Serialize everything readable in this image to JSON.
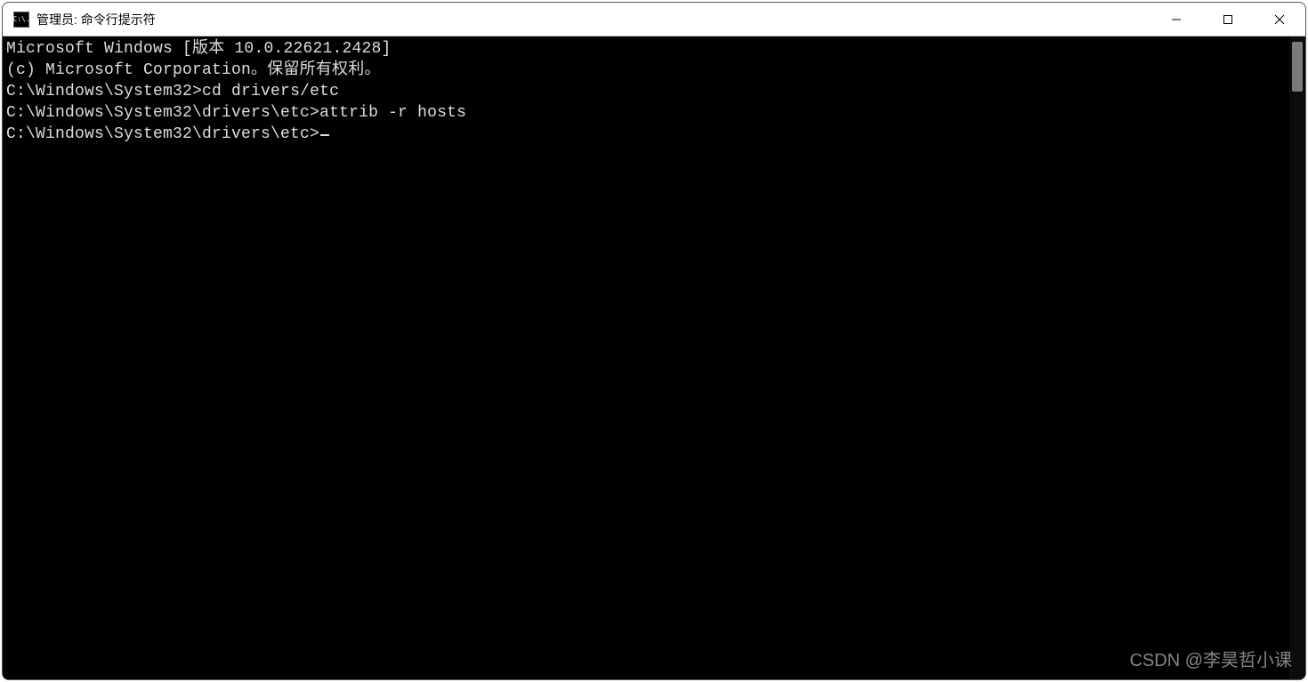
{
  "title": "管理员: 命令行提示符",
  "icon_glyph": "C:\\.",
  "terminal": {
    "banner_line1": "Microsoft Windows [版本 10.0.22621.2428]",
    "banner_line2": "(c) Microsoft Corporation。保留所有权利。",
    "blank1": "",
    "line1_prompt": "C:\\Windows\\System32>",
    "line1_cmd": "cd drivers/etc",
    "blank2": "",
    "line2_prompt": "C:\\Windows\\System32\\drivers\\etc>",
    "line2_cmd": "attrib -r hosts",
    "blank3": "",
    "line3_prompt": "C:\\Windows\\System32\\drivers\\etc>",
    "line3_cmd": ""
  },
  "watermark": "CSDN @李昊哲小课"
}
